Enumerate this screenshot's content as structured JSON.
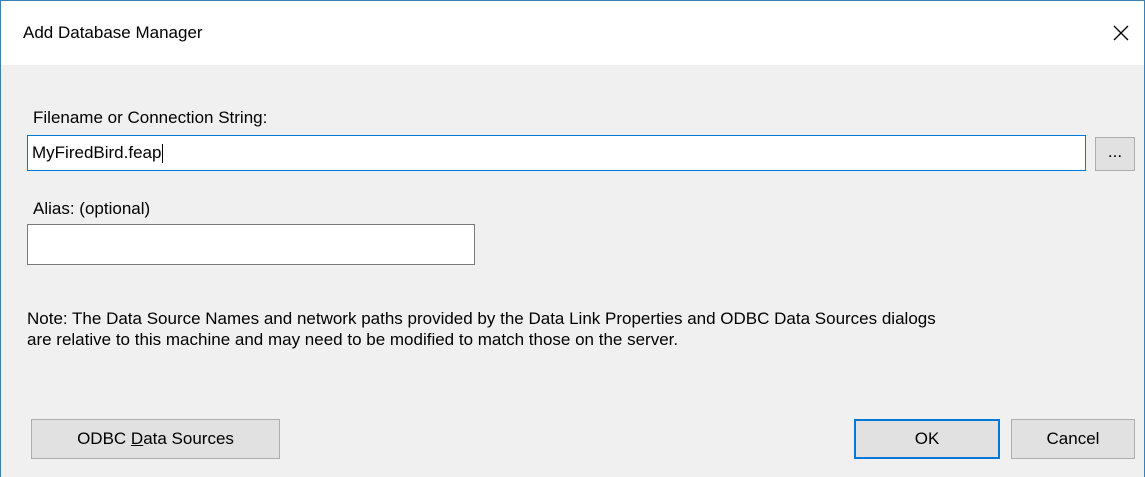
{
  "window": {
    "title": "Add Database Manager",
    "close_icon": "close-icon"
  },
  "form": {
    "connection_label": "Filename or Connection String:",
    "connection_value": "MyFiredBird.feap",
    "browse_label": "...",
    "alias_label": "Alias: (optional)",
    "alias_value": ""
  },
  "note": {
    "line1": "Note: The Data Source Names and network paths provided by the Data Link Properties and ODBC Data Sources dialogs",
    "line2": "are relative to this machine and may need to be modified to match those on the server."
  },
  "buttons": {
    "odbc_prefix": "ODBC ",
    "odbc_mnemonic": "D",
    "odbc_suffix": "ata Sources",
    "ok": "OK",
    "cancel": "Cancel"
  },
  "colors": {
    "accent": "#0078d7",
    "dialog_bg": "#f0f0f0",
    "window_border": "#3c7fb1"
  }
}
